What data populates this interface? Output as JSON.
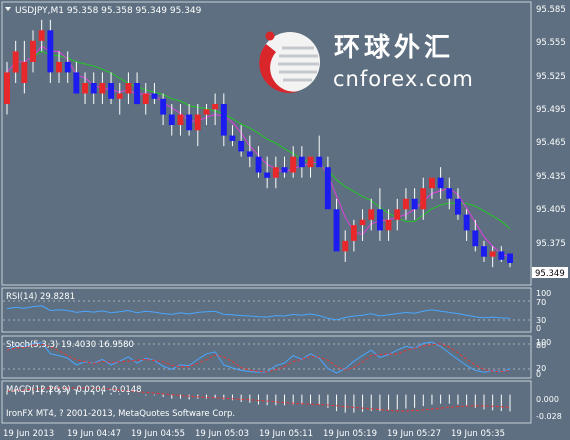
{
  "colors": {
    "background": "#5d6f80",
    "frame": "#c8d0d8",
    "text": "#ffffff",
    "grid": "#8794a2",
    "bull": "#e8282a",
    "bear": "#1c1cf0",
    "wick": "#ffffff",
    "ma_fast": "#e040e0",
    "ma_slow": "#22c822",
    "osc_blue": "#4aa6ff",
    "osc_red": "#e83434"
  },
  "header": {
    "menu_icon": "triangle-down-icon",
    "title": "USDJPY,M1  95.358 95.358 95.349 95.349"
  },
  "logo": {
    "icon": "cnforex-globe-icon",
    "chinese": "环球外汇",
    "latin": "cnforex.com"
  },
  "footer": {
    "copyright": "IronFX MT4, ? 2001-2013, MetaQuotes Software Corp."
  },
  "chart_data": {
    "type": "candlestick",
    "symbol": "USDJPY",
    "timeframe": "M1",
    "ohlc_header": {
      "open": 95.358,
      "high": 95.358,
      "low": 95.349,
      "close": 95.349
    },
    "ylim": [
      95.33,
      95.595
    ],
    "price_ticks": [
      "95.585",
      "95.555",
      "95.525",
      "95.495",
      "95.465",
      "95.435",
      "95.405",
      "95.375"
    ],
    "current_price_label": "95.349",
    "candles": [
      {
        "o": 95.5,
        "h": 95.54,
        "l": 95.49,
        "c": 95.53
      },
      {
        "o": 95.53,
        "h": 95.56,
        "l": 95.52,
        "c": 95.55
      },
      {
        "o": 95.52,
        "h": 95.56,
        "l": 95.51,
        "c": 95.54
      },
      {
        "o": 95.54,
        "h": 95.57,
        "l": 95.53,
        "c": 95.56
      },
      {
        "o": 95.56,
        "h": 95.58,
        "l": 95.55,
        "c": 95.57
      },
      {
        "o": 95.57,
        "h": 95.58,
        "l": 95.52,
        "c": 95.53
      },
      {
        "o": 95.53,
        "h": 95.55,
        "l": 95.52,
        "c": 95.54
      },
      {
        "o": 95.54,
        "h": 95.55,
        "l": 95.52,
        "c": 95.53
      },
      {
        "o": 95.53,
        "h": 95.54,
        "l": 95.51,
        "c": 95.51
      },
      {
        "o": 95.51,
        "h": 95.53,
        "l": 95.5,
        "c": 95.52
      },
      {
        "o": 95.52,
        "h": 95.53,
        "l": 95.5,
        "c": 95.51
      },
      {
        "o": 95.51,
        "h": 95.53,
        "l": 95.5,
        "c": 95.52
      },
      {
        "o": 95.52,
        "h": 95.53,
        "l": 95.5,
        "c": 95.505
      },
      {
        "o": 95.505,
        "h": 95.52,
        "l": 95.49,
        "c": 95.51
      },
      {
        "o": 95.51,
        "h": 95.53,
        "l": 95.5,
        "c": 95.52
      },
      {
        "o": 95.52,
        "h": 95.53,
        "l": 95.5,
        "c": 95.5
      },
      {
        "o": 95.5,
        "h": 95.52,
        "l": 95.49,
        "c": 95.51
      },
      {
        "o": 95.51,
        "h": 95.52,
        "l": 95.5,
        "c": 95.505
      },
      {
        "o": 95.505,
        "h": 95.51,
        "l": 95.48,
        "c": 95.49
      },
      {
        "o": 95.49,
        "h": 95.5,
        "l": 95.47,
        "c": 95.48
      },
      {
        "o": 95.48,
        "h": 95.5,
        "l": 95.47,
        "c": 95.49
      },
      {
        "o": 95.49,
        "h": 95.5,
        "l": 95.47,
        "c": 95.475
      },
      {
        "o": 95.475,
        "h": 95.5,
        "l": 95.46,
        "c": 95.49
      },
      {
        "o": 95.49,
        "h": 95.5,
        "l": 95.48,
        "c": 95.495
      },
      {
        "o": 95.495,
        "h": 95.51,
        "l": 95.48,
        "c": 95.5
      },
      {
        "o": 95.5,
        "h": 95.51,
        "l": 95.46,
        "c": 95.47
      },
      {
        "o": 95.47,
        "h": 95.48,
        "l": 95.46,
        "c": 95.465
      },
      {
        "o": 95.465,
        "h": 95.48,
        "l": 95.45,
        "c": 95.455
      },
      {
        "o": 95.455,
        "h": 95.47,
        "l": 95.44,
        "c": 95.45
      },
      {
        "o": 95.45,
        "h": 95.46,
        "l": 95.43,
        "c": 95.435
      },
      {
        "o": 95.435,
        "h": 95.45,
        "l": 95.42,
        "c": 95.43
      },
      {
        "o": 95.43,
        "h": 95.45,
        "l": 95.42,
        "c": 95.44
      },
      {
        "o": 95.44,
        "h": 95.45,
        "l": 95.43,
        "c": 95.435
      },
      {
        "o": 95.435,
        "h": 95.46,
        "l": 95.43,
        "c": 95.45
      },
      {
        "o": 95.45,
        "h": 95.46,
        "l": 95.43,
        "c": 95.44
      },
      {
        "o": 95.44,
        "h": 95.45,
        "l": 95.43,
        "c": 95.45
      },
      {
        "o": 95.45,
        "h": 95.47,
        "l": 95.44,
        "c": 95.44
      },
      {
        "o": 95.44,
        "h": 95.45,
        "l": 95.4,
        "c": 95.4
      },
      {
        "o": 95.4,
        "h": 95.41,
        "l": 95.36,
        "c": 95.36
      },
      {
        "o": 95.36,
        "h": 95.38,
        "l": 95.35,
        "c": 95.37
      },
      {
        "o": 95.37,
        "h": 95.39,
        "l": 95.36,
        "c": 95.385
      },
      {
        "o": 95.385,
        "h": 95.4,
        "l": 95.37,
        "c": 95.39
      },
      {
        "o": 95.39,
        "h": 95.41,
        "l": 95.38,
        "c": 95.4
      },
      {
        "o": 95.4,
        "h": 95.42,
        "l": 95.37,
        "c": 95.38
      },
      {
        "o": 95.38,
        "h": 95.4,
        "l": 95.37,
        "c": 95.39
      },
      {
        "o": 95.39,
        "h": 95.41,
        "l": 95.38,
        "c": 95.4
      },
      {
        "o": 95.4,
        "h": 95.42,
        "l": 95.39,
        "c": 95.41
      },
      {
        "o": 95.41,
        "h": 95.42,
        "l": 95.39,
        "c": 95.4
      },
      {
        "o": 95.4,
        "h": 95.43,
        "l": 95.39,
        "c": 95.42
      },
      {
        "o": 95.42,
        "h": 95.43,
        "l": 95.41,
        "c": 95.43
      },
      {
        "o": 95.43,
        "h": 95.44,
        "l": 95.41,
        "c": 95.42
      },
      {
        "o": 95.42,
        "h": 95.43,
        "l": 95.4,
        "c": 95.41
      },
      {
        "o": 95.41,
        "h": 95.42,
        "l": 95.39,
        "c": 95.395
      },
      {
        "o": 95.395,
        "h": 95.4,
        "l": 95.37,
        "c": 95.38
      },
      {
        "o": 95.38,
        "h": 95.39,
        "l": 95.36,
        "c": 95.365
      },
      {
        "o": 95.365,
        "h": 95.37,
        "l": 95.35,
        "c": 95.355
      },
      {
        "o": 95.355,
        "h": 95.365,
        "l": 95.345,
        "c": 95.36
      },
      {
        "o": 95.36,
        "h": 95.365,
        "l": 95.35,
        "c": 95.352
      },
      {
        "o": 95.358,
        "h": 95.358,
        "l": 95.345,
        "c": 95.349
      }
    ],
    "ma_fast_label": "short moving average (magenta)",
    "ma_slow_label": "long moving average (green)",
    "x_ticks": [
      "19 Jun 2013",
      "19 Jun 04:47",
      "19 Jun 04:55",
      "19 Jun 05:03",
      "19 Jun 05:11",
      "19 Jun 05:19",
      "19 Jun 05:27",
      "19 Jun 05:35"
    ],
    "rsi": {
      "label": "RSI(14) 29.8281",
      "value": 29.8281,
      "ylim": [
        0,
        100
      ],
      "ticks": [
        "100",
        "70",
        "30",
        "0"
      ],
      "levels": [
        70,
        30
      ],
      "values": [
        55,
        58,
        56,
        60,
        62,
        50,
        52,
        50,
        45,
        48,
        46,
        49,
        44,
        47,
        50,
        44,
        48,
        46,
        42,
        40,
        44,
        41,
        45,
        47,
        48,
        40,
        39,
        37,
        36,
        34,
        33,
        37,
        36,
        40,
        38,
        41,
        37,
        30,
        26,
        32,
        36,
        38,
        42,
        36,
        39,
        42,
        45,
        43,
        48,
        52,
        48,
        45,
        42,
        38,
        34,
        31,
        33,
        31,
        30
      ]
    },
    "stoch": {
      "label": "Stoch(5,3,3) 19.4030 16.9580",
      "main": 19.403,
      "signal": 16.958,
      "ylim": [
        0,
        100
      ],
      "ticks": [
        "100",
        "80",
        "20",
        "0"
      ],
      "levels": [
        80,
        20
      ],
      "main_values": [
        70,
        82,
        80,
        88,
        90,
        60,
        55,
        48,
        30,
        38,
        35,
        45,
        30,
        40,
        52,
        35,
        48,
        42,
        26,
        18,
        30,
        28,
        45,
        60,
        65,
        30,
        22,
        15,
        12,
        10,
        12,
        28,
        35,
        55,
        45,
        60,
        48,
        20,
        8,
        20,
        40,
        55,
        70,
        50,
        58,
        70,
        80,
        75,
        88,
        92,
        80,
        62,
        45,
        28,
        15,
        10,
        14,
        12,
        19
      ]
    },
    "macd": {
      "label": "MACD(12,26,9) -0.0204 -0.0148",
      "macd": -0.0204,
      "signal": -0.0148,
      "ylim": [
        -0.032,
        0.014
      ],
      "ticks": [
        "0.000",
        "-0.028"
      ],
      "hist_values": [
        0.004,
        0.006,
        0.007,
        0.009,
        0.011,
        0.01,
        0.009,
        0.008,
        0.006,
        0.005,
        0.004,
        0.004,
        0.002,
        0.001,
        0.002,
        0.0,
        -0.001,
        -0.001,
        -0.003,
        -0.005,
        -0.005,
        -0.006,
        -0.005,
        -0.005,
        -0.004,
        -0.006,
        -0.007,
        -0.009,
        -0.01,
        -0.012,
        -0.013,
        -0.013,
        -0.013,
        -0.012,
        -0.012,
        -0.011,
        -0.012,
        -0.016,
        -0.02,
        -0.022,
        -0.022,
        -0.021,
        -0.02,
        -0.02,
        -0.019,
        -0.018,
        -0.017,
        -0.016,
        -0.014,
        -0.012,
        -0.011,
        -0.011,
        -0.012,
        -0.014,
        -0.016,
        -0.018,
        -0.019,
        -0.02,
        -0.0204
      ]
    }
  }
}
